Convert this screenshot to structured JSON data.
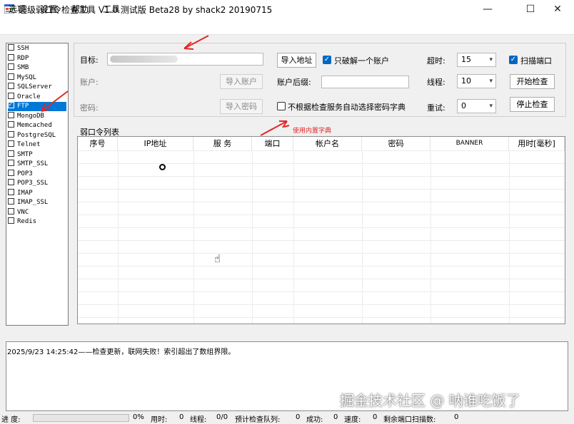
{
  "window": {
    "title": "超级弱口令检查工具 V1.0 测试版 Beta28 by shack2 20190715",
    "min_symbol": "—",
    "max_symbol": "☐",
    "close_symbol": "✕"
  },
  "menu": {
    "options": "选项",
    "settings": "设置",
    "help": "帮助",
    "tools": "工具"
  },
  "services": [
    {
      "label": "SSH",
      "checked": false
    },
    {
      "label": "RDP",
      "checked": false
    },
    {
      "label": "SMB",
      "checked": false
    },
    {
      "label": "MySQL",
      "checked": false
    },
    {
      "label": "SQLServer",
      "checked": false
    },
    {
      "label": "Oracle",
      "checked": false
    },
    {
      "label": "FTP",
      "checked": true
    },
    {
      "label": "MongoDB",
      "checked": false
    },
    {
      "label": "Memcached",
      "checked": false
    },
    {
      "label": "PostgreSQL",
      "checked": false
    },
    {
      "label": "Telnet",
      "checked": false
    },
    {
      "label": "SMTP",
      "checked": false
    },
    {
      "label": "SMTP_SSL",
      "checked": false
    },
    {
      "label": "POP3",
      "checked": false
    },
    {
      "label": "POP3_SSL",
      "checked": false
    },
    {
      "label": "IMAP",
      "checked": false
    },
    {
      "label": "IMAP_SSL",
      "checked": false
    },
    {
      "label": "VNC",
      "checked": false
    },
    {
      "label": "Redis",
      "checked": false
    }
  ],
  "form": {
    "target_label": "目标:",
    "account_label": "账户:",
    "password_label": "密码:",
    "import_account": "导入账户",
    "import_password": "导入密码",
    "import_address": "导入地址",
    "crack_one_label": "只破解一个账户",
    "crack_one_checked": true,
    "suffix_label": "账户后缀:",
    "no_auto_dict_label": "不根据检查服务自动选择密码字典",
    "no_auto_dict_checked": false,
    "timeout_label": "超时:",
    "timeout_value": "15",
    "threads_label": "线程:",
    "threads_value": "10",
    "retry_label": "重试:",
    "retry_value": "0",
    "scan_port_label": "扫描端口",
    "scan_port_checked": true,
    "start_button": "开始检查",
    "stop_button": "停止检查"
  },
  "annotation": {
    "builtin_dict": "使用内置字典",
    "color": "#e32727"
  },
  "table": {
    "title": "弱口令列表",
    "columns": [
      "序号",
      "IP地址",
      "服 务",
      "端口",
      "帐户名",
      "密码",
      "BANNER",
      "用时[毫秒]"
    ]
  },
  "log": {
    "line": "2025/9/23 14:25:42——检查更新，联网失败！索引超出了数组界限。"
  },
  "status": {
    "progress_label": "进 度:",
    "progress_pct": "0%",
    "elapsed_label": "用时:",
    "elapsed_value": "0",
    "thread_label": "线程:",
    "thread_value": "0/0",
    "queue_label": "预计检查队列:",
    "queue_value": "0",
    "success_label": "成功:",
    "success_value": "0",
    "speed_label": "速度:",
    "speed_value": "0",
    "remaining_label": "剩余端口扫描数:",
    "remaining_value": "0"
  },
  "watermark": "掘金技术社区 @ 呐谁吃饭了",
  "colors": {
    "accent": "#0078d7",
    "checkbox": "#0067c0",
    "annotation": "#e32727"
  }
}
